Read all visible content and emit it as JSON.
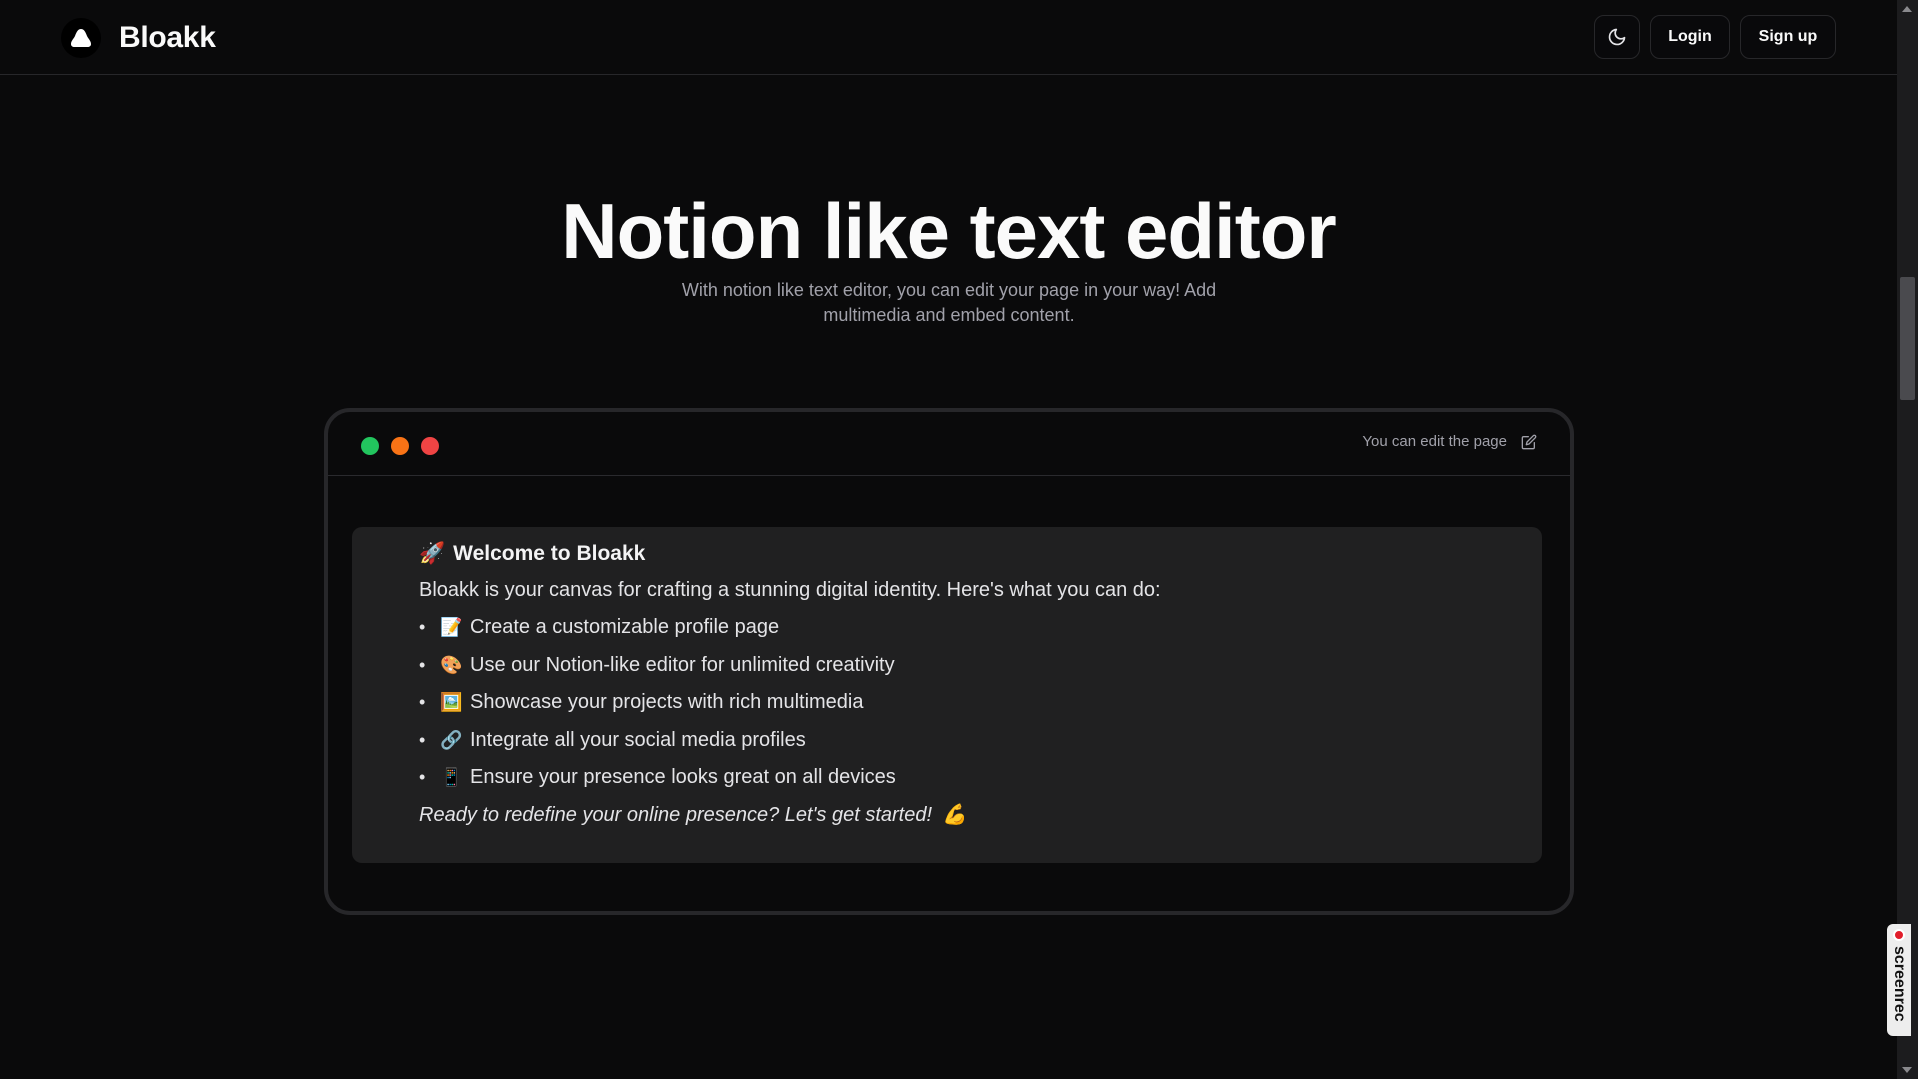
{
  "header": {
    "brand_name": "Bloakk",
    "theme_toggle_icon": "moon-icon",
    "login_label": "Login",
    "signup_label": "Sign up"
  },
  "hero": {
    "title": "Notion like text editor",
    "subtitle": "With notion like text editor, you can edit your page in your way! Add multimedia and embed content."
  },
  "window": {
    "dots": [
      "#22c55e",
      "#f97316",
      "#ef4444"
    ],
    "edit_hint": "You can edit the page",
    "edit_icon": "pencil-square-icon"
  },
  "editor": {
    "heading_emoji": "🚀",
    "heading": "Welcome to Bloakk",
    "intro": "Bloakk is your canvas for crafting a stunning digital identity. Here's what you can do:",
    "items": [
      {
        "emoji": "📝",
        "text": "Create a customizable profile page"
      },
      {
        "emoji": "🎨",
        "text": "Use our Notion-like editor for unlimited creativity"
      },
      {
        "emoji": "🖼️",
        "text": "Showcase your projects with rich multimedia"
      },
      {
        "emoji": "🔗",
        "text": "Integrate all your social media profiles"
      },
      {
        "emoji": "📱",
        "text": "Ensure your presence looks great on all devices"
      }
    ],
    "closing": "Ready to redefine your online presence? Let's get started!",
    "closing_emoji": "💪"
  },
  "overlay": {
    "badge_text": "screenrec"
  }
}
